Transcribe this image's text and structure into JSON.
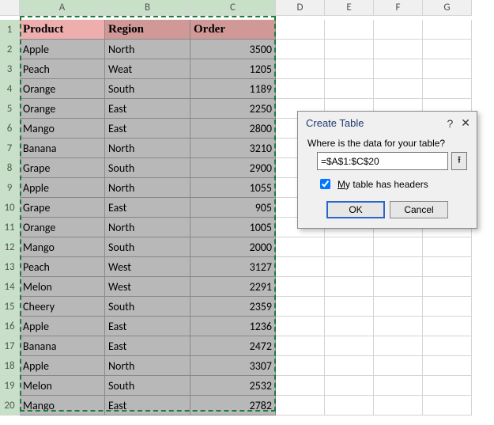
{
  "columns": [
    "A",
    "B",
    "C",
    "D",
    "E",
    "F",
    "G"
  ],
  "selected_cols": [
    "A",
    "B",
    "C"
  ],
  "row_count": 20,
  "headers": [
    "Product",
    "Region",
    "Order"
  ],
  "rows": [
    {
      "product": "Apple",
      "region": "North",
      "order": 3500
    },
    {
      "product": "Peach",
      "region": "Weat",
      "order": 1205
    },
    {
      "product": "Orange",
      "region": "South",
      "order": 1189
    },
    {
      "product": "Orange",
      "region": "East",
      "order": 2250
    },
    {
      "product": "Mango",
      "region": "East",
      "order": 2800
    },
    {
      "product": "Banana",
      "region": "North",
      "order": 3210
    },
    {
      "product": "Grape",
      "region": "South",
      "order": 2900
    },
    {
      "product": "Apple",
      "region": "North",
      "order": 1055
    },
    {
      "product": "Grape",
      "region": "East",
      "order": 905
    },
    {
      "product": "Orange",
      "region": "North",
      "order": 1005
    },
    {
      "product": "Mango",
      "region": "South",
      "order": 2000
    },
    {
      "product": "Peach",
      "region": "West",
      "order": 3127
    },
    {
      "product": "Melon",
      "region": "West",
      "order": 2291
    },
    {
      "product": "Cheery",
      "region": "South",
      "order": 2359
    },
    {
      "product": "Apple",
      "region": "East",
      "order": 1236
    },
    {
      "product": "Banana",
      "region": "East",
      "order": 2472
    },
    {
      "product": "Apple",
      "region": "North",
      "order": 3307
    },
    {
      "product": "Melon",
      "region": "South",
      "order": 2532
    },
    {
      "product": "Mango",
      "region": "East",
      "order": 2782
    }
  ],
  "dialog": {
    "title": "Create Table",
    "help_icon": "?",
    "close_icon": "✕",
    "prompt": "Where is the data for your table?",
    "range": "=$A$1:$C$20",
    "checkbox_label_pre": "M",
    "checkbox_label_rest": "y table has headers",
    "checkbox_checked": true,
    "ok": "OK",
    "cancel": "Cancel",
    "collapse_icon": "⭱"
  }
}
